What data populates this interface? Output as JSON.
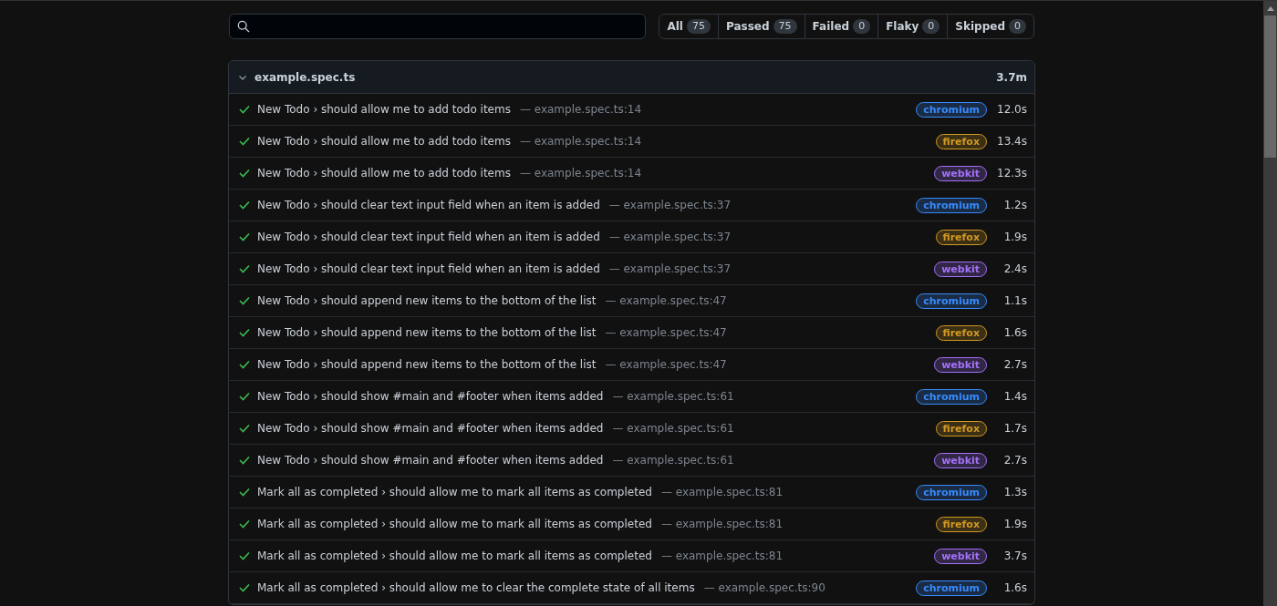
{
  "filters": [
    {
      "label": "All",
      "count": "75",
      "selected": false
    },
    {
      "label": "Passed",
      "count": "75",
      "selected": false
    },
    {
      "label": "Failed",
      "count": "0",
      "selected": false
    },
    {
      "label": "Flaky",
      "count": "0",
      "selected": false
    },
    {
      "label": "Skipped",
      "count": "0",
      "selected": false
    }
  ],
  "file": {
    "name": "example.spec.ts",
    "duration": "3.7m",
    "expanded": true
  },
  "tests": [
    {
      "title": "New Todo › should allow me to add todo items",
      "location": "— example.spec.ts:14",
      "project": "chromium",
      "color": "#388bfd",
      "duration": "12.0s"
    },
    {
      "title": "New Todo › should allow me to add todo items",
      "location": "— example.spec.ts:14",
      "project": "firefox",
      "color": "#d29922",
      "duration": "13.4s"
    },
    {
      "title": "New Todo › should allow me to add todo items",
      "location": "— example.spec.ts:14",
      "project": "webkit",
      "color": "#a371f7",
      "duration": "12.3s"
    },
    {
      "title": "New Todo › should clear text input field when an item is added",
      "location": "— example.spec.ts:37",
      "project": "chromium",
      "color": "#388bfd",
      "duration": "1.2s"
    },
    {
      "title": "New Todo › should clear text input field when an item is added",
      "location": "— example.spec.ts:37",
      "project": "firefox",
      "color": "#d29922",
      "duration": "1.9s"
    },
    {
      "title": "New Todo › should clear text input field when an item is added",
      "location": "— example.spec.ts:37",
      "project": "webkit",
      "color": "#a371f7",
      "duration": "2.4s"
    },
    {
      "title": "New Todo › should append new items to the bottom of the list",
      "location": "— example.spec.ts:47",
      "project": "chromium",
      "color": "#388bfd",
      "duration": "1.1s"
    },
    {
      "title": "New Todo › should append new items to the bottom of the list",
      "location": "— example.spec.ts:47",
      "project": "firefox",
      "color": "#d29922",
      "duration": "1.6s"
    },
    {
      "title": "New Todo › should append new items to the bottom of the list",
      "location": "— example.spec.ts:47",
      "project": "webkit",
      "color": "#a371f7",
      "duration": "2.7s"
    },
    {
      "title": "New Todo › should show #main and #footer when items added",
      "location": "— example.spec.ts:61",
      "project": "chromium",
      "color": "#388bfd",
      "duration": "1.4s"
    },
    {
      "title": "New Todo › should show #main and #footer when items added",
      "location": "— example.spec.ts:61",
      "project": "firefox",
      "color": "#d29922",
      "duration": "1.7s"
    },
    {
      "title": "New Todo › should show #main and #footer when items added",
      "location": "— example.spec.ts:61",
      "project": "webkit",
      "color": "#a371f7",
      "duration": "2.7s"
    },
    {
      "title": "Mark all as completed › should allow me to mark all items as completed",
      "location": "— example.spec.ts:81",
      "project": "chromium",
      "color": "#388bfd",
      "duration": "1.3s"
    },
    {
      "title": "Mark all as completed › should allow me to mark all items as completed",
      "location": "— example.spec.ts:81",
      "project": "firefox",
      "color": "#d29922",
      "duration": "1.9s"
    },
    {
      "title": "Mark all as completed › should allow me to mark all items as completed",
      "location": "— example.spec.ts:81",
      "project": "webkit",
      "color": "#a371f7",
      "duration": "3.7s"
    },
    {
      "title": "Mark all as completed › should allow me to clear the complete state of all items",
      "location": "— example.spec.ts:90",
      "project": "chromium",
      "color": "#388bfd",
      "duration": "1.6s"
    }
  ]
}
